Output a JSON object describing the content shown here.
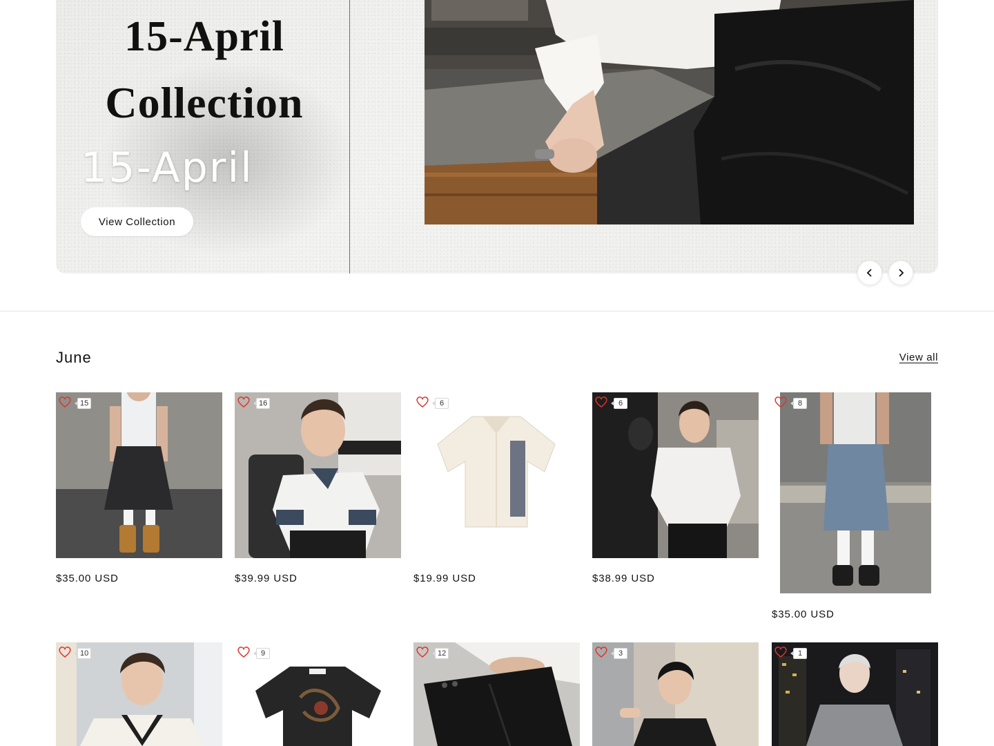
{
  "hero": {
    "title_line1": "15-April",
    "title_line2": "Collection",
    "date_text": "15-April",
    "button_label": "View Collection",
    "prev_icon": "chevron-left-icon",
    "next_icon": "chevron-right-icon"
  },
  "collection": {
    "title": "June",
    "view_all_label": "View all",
    "products": [
      {
        "likes": "15",
        "price": "$35.00 USD",
        "image": "model in white tank top and black denim jorts with boots"
      },
      {
        "likes": "16",
        "price": "$39.99 USD",
        "image": "model in white polo with denim collar seated"
      },
      {
        "likes": "6",
        "price": "$19.99 USD",
        "image": "cream short-sleeve shirt with printed panel"
      },
      {
        "likes": "6",
        "price": "$38.99 USD",
        "image": "model in white textured shirt by mirror"
      },
      {
        "likes": "8",
        "price": "$35.00 USD",
        "image": "model in white tank and light denim shorts from behind"
      },
      {
        "likes": "10",
        "image": "model in white knit v-neck vest"
      },
      {
        "likes": "9",
        "image": "black graphic oversized t-shirt"
      },
      {
        "likes": "12",
        "image": "black pleated shorts"
      },
      {
        "likes": "3",
        "image": "model in black sleeveless top by window"
      },
      {
        "likes": "1",
        "image": "model in grey mesh top at night"
      }
    ]
  },
  "colors": {
    "heart": "#e2322b",
    "text": "#121212",
    "rule": "#e5e5e5"
  }
}
